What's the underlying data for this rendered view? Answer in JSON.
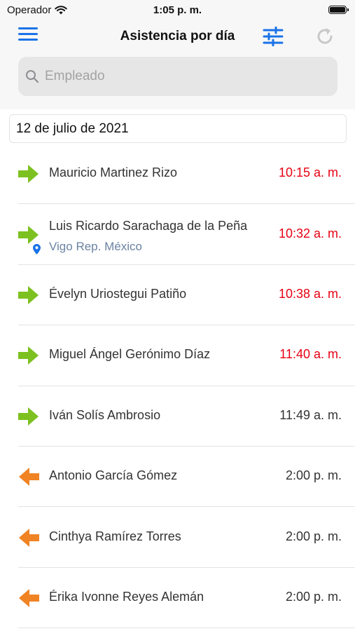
{
  "status_bar": {
    "carrier": "Operador",
    "time": "1:05 p. m."
  },
  "nav": {
    "title": "Asistencia por día"
  },
  "search": {
    "placeholder": "Empleado",
    "value": ""
  },
  "date": "12 de julio de 2021",
  "colors": {
    "accent": "#1a73e8",
    "entry_arrow": "#7cc120",
    "exit_arrow": "#f08324",
    "late_time": "#e60012",
    "location_text": "#6b83a3"
  },
  "records": [
    {
      "type": "entrada",
      "icon": "arrow-right-icon",
      "name": "Mauricio Martinez Rizo",
      "location": "",
      "time": "10:15 a. m.",
      "late": true
    },
    {
      "type": "entrada",
      "icon": "arrow-right-icon",
      "name": "Luis Ricardo Sarachaga de la Peña",
      "location": "Vigo Rep. México",
      "time": "10:32 a. m.",
      "late": true
    },
    {
      "type": "entrada",
      "icon": "arrow-right-icon",
      "name": "Évelyn Uriostegui Patiño",
      "location": "",
      "time": "10:38 a. m.",
      "late": true
    },
    {
      "type": "entrada",
      "icon": "arrow-right-icon",
      "name": "Miguel Ángel Gerónimo Díaz",
      "location": "",
      "time": "11:40 a. m.",
      "late": true
    },
    {
      "type": "entrada",
      "icon": "arrow-right-icon",
      "name": "Iván Solís Ambrosio",
      "location": "",
      "time": "11:49 a. m.",
      "late": false
    },
    {
      "type": "salida",
      "icon": "arrow-left-icon",
      "name": "Antonio García Gómez",
      "location": "",
      "time": "2:00 p. m.",
      "late": false
    },
    {
      "type": "salida",
      "icon": "arrow-left-icon",
      "name": "Cinthya Ramírez Torres",
      "location": "",
      "time": "2:00 p. m.",
      "late": false
    },
    {
      "type": "salida",
      "icon": "arrow-left-icon",
      "name": "Érika Ivonne Reyes Alemán",
      "location": "",
      "time": "2:00 p. m.",
      "late": false
    }
  ]
}
